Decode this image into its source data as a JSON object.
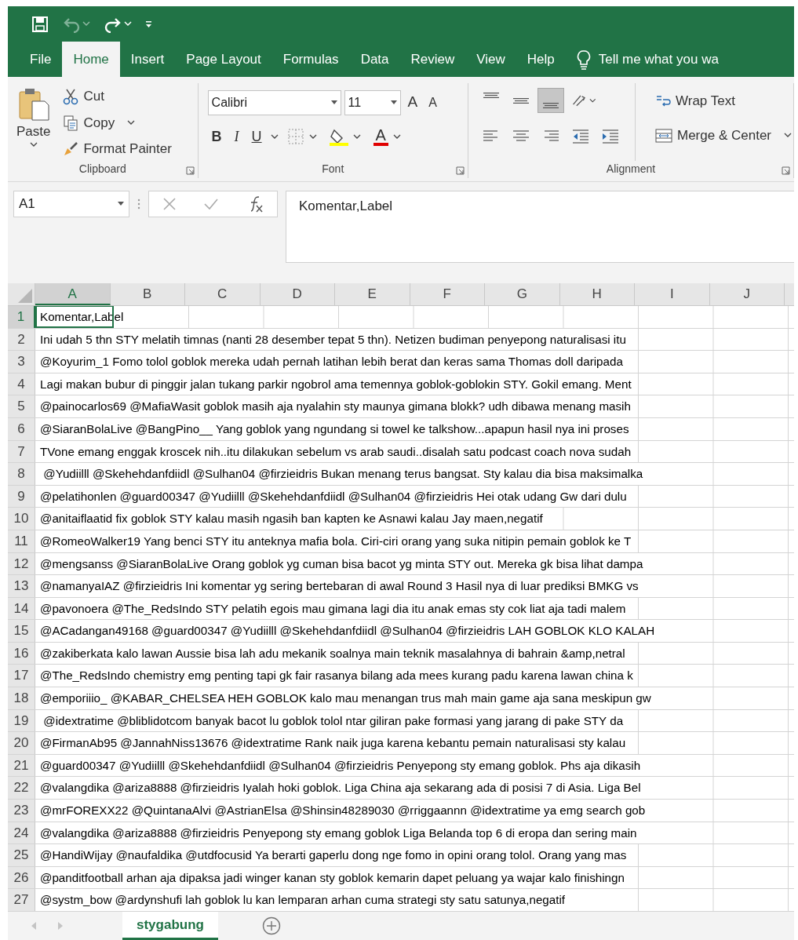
{
  "quick_access": {
    "items": [
      {
        "kind": "save",
        "disabled": false
      },
      {
        "kind": "undo",
        "disabled": true
      },
      {
        "kind": "redo",
        "disabled": false
      },
      {
        "kind": "customize",
        "disabled": false
      }
    ]
  },
  "tabs": [
    {
      "label": "File",
      "selected": false
    },
    {
      "label": "Home",
      "selected": true
    },
    {
      "label": "Insert",
      "selected": false
    },
    {
      "label": "Page Layout",
      "selected": false
    },
    {
      "label": "Formulas",
      "selected": false
    },
    {
      "label": "Data",
      "selected": false
    },
    {
      "label": "Review",
      "selected": false
    },
    {
      "label": "View",
      "selected": false
    },
    {
      "label": "Help",
      "selected": false
    }
  ],
  "tell_me": "Tell me what you wa",
  "ribbon": {
    "clipboard": {
      "label": "Clipboard",
      "paste": "Paste",
      "cut": "Cut",
      "copy": "Copy",
      "format_painter": "Format Painter"
    },
    "font": {
      "label": "Font",
      "font_name": "Calibri",
      "font_size": "11",
      "grow": "A",
      "shrink": "A",
      "bold": "B",
      "italic": "I",
      "underline": "U",
      "font_color": "A"
    },
    "alignment": {
      "label": "Alignment",
      "wrap_text": "Wrap Text",
      "merge_center": "Merge & Center",
      "buttons": [
        {
          "kind": "top",
          "pressed": false
        },
        {
          "kind": "middle",
          "pressed": false
        },
        {
          "kind": "bottom",
          "pressed": true
        },
        {
          "kind": "orientation",
          "pressed": false
        },
        {
          "kind": "left",
          "pressed": false
        },
        {
          "kind": "center",
          "pressed": false
        },
        {
          "kind": "right",
          "pressed": false
        },
        {
          "kind": "outdent",
          "pressed": false
        },
        {
          "kind": "indent",
          "pressed": false
        }
      ]
    }
  },
  "name_box": "A1",
  "formula": "Komentar,Label",
  "columns": [
    {
      "label": "A",
      "selected": true
    },
    {
      "label": "B",
      "selected": false
    },
    {
      "label": "C",
      "selected": false
    },
    {
      "label": "D",
      "selected": false
    },
    {
      "label": "E",
      "selected": false
    },
    {
      "label": "F",
      "selected": false
    },
    {
      "label": "G",
      "selected": false
    },
    {
      "label": "H",
      "selected": false
    },
    {
      "label": "I",
      "selected": false
    },
    {
      "label": "J",
      "selected": false
    }
  ],
  "rows": [
    {
      "number": "1",
      "selected": true,
      "text": "Komentar,Label"
    },
    {
      "number": "2",
      "selected": false,
      "text": "Ini udah 5 thn STY melatih timnas (nanti 28 desember tepat 5 thn). Netizen budiman penyepong naturalisasi itu"
    },
    {
      "number": "3",
      "selected": false,
      "text": "@Koyurim_1 Fomo tolol goblok mereka udah pernah latihan lebih berat dan keras sama Thomas doll daripada"
    },
    {
      "number": "4",
      "selected": false,
      "text": "Lagi makan bubur di pinggir jalan tukang parkir ngobrol ama temennya goblok-goblokin STY. Gokil emang. Ment"
    },
    {
      "number": "5",
      "selected": false,
      "text": "@painocarlos69 @MafiaWasit goblok masih aja nyalahin sty maunya gimana blokk? udh dibawa menang masih"
    },
    {
      "number": "6",
      "selected": false,
      "text": "@SiaranBolaLive @BangPino__ Yang goblok yang ngundang si towel ke talkshow...apapun hasil nya ini proses"
    },
    {
      "number": "7",
      "selected": false,
      "text": "TVone emang enggak kroscek nih..itu dilakukan sebelum vs arab saudi..disalah satu podcast coach nova sudah"
    },
    {
      "number": "8",
      "selected": false,
      "text": " @Yudiilll @Skehehdanfdiidl @Sulhan04 @firzieidris Bukan menang terus bangsat. Sty kalau dia bisa maksimalka"
    },
    {
      "number": "9",
      "selected": false,
      "text": "@pelatihonlen @guard00347 @Yudiilll @Skehehdanfdiidl @Sulhan04 @firzieidris Hei otak udang Gw dari dulu"
    },
    {
      "number": "10",
      "selected": false,
      "text": "@anitaiflaatid fix goblok STY kalau masih ngasih ban kapten ke Asnawi kalau Jay maen,negatif"
    },
    {
      "number": "11",
      "selected": false,
      "text": "@RomeoWalker19 Yang benci STY itu anteknya mafia bola. Ciri-ciri orang yang suka nitipin pemain goblok ke T"
    },
    {
      "number": "12",
      "selected": false,
      "text": "@mengsanss @SiaranBolaLive Orang goblok yg cuman bisa bacot yg minta STY out. Mereka gk bisa lihat dampa"
    },
    {
      "number": "13",
      "selected": false,
      "text": "@namanyaIAZ @firzieidris Ini komentar yg sering bertebaran di awal Round 3 Hasil nya di luar prediksi BMKG vs"
    },
    {
      "number": "14",
      "selected": false,
      "text": "@pavonoera @The_RedsIndo STY pelatih egois mau gimana lagi dia itu anak emas sty cok liat aja tadi malem"
    },
    {
      "number": "15",
      "selected": false,
      "text": "@ACadangan49168 @guard00347 @Yudiilll @Skehehdanfdiidl @Sulhan04 @firzieidris LAH GOBLOK KLO KALAH"
    },
    {
      "number": "16",
      "selected": false,
      "text": "@zakiberkata kalo lawan Aussie bisa lah adu mekanik soalnya main teknik masalahnya di bahrain &amp,netral"
    },
    {
      "number": "17",
      "selected": false,
      "text": "@The_RedsIndo chemistry emg penting tapi gk fair rasanya bilang ada mees kurang padu karena lawan china k"
    },
    {
      "number": "18",
      "selected": false,
      "text": "@emporiiio_ @KABAR_CHELSEA HEH GOBLOK kalo mau menangan trus mah main game aja sana meskipun gw"
    },
    {
      "number": "19",
      "selected": false,
      "text": " @idextratime @bliblidotcom banyak bacot lu goblok tolol ntar giliran pake formasi yang jarang di pake STY da"
    },
    {
      "number": "20",
      "selected": false,
      "text": "@FirmanAb95 @JannahNiss13676 @idextratime Rank naik juga karena kebantu pemain naturalisasi sty kalau"
    },
    {
      "number": "21",
      "selected": false,
      "text": "@guard00347 @Yudiilll @Skehehdanfdiidl @Sulhan04 @firzieidris Penyepong sty emang goblok. Phs aja dikasih"
    },
    {
      "number": "22",
      "selected": false,
      "text": "@valangdika @ariza8888 @firzieidris Iyalah hoki goblok. Liga China aja sekarang ada di posisi 7 di Asia. Liga Bel"
    },
    {
      "number": "23",
      "selected": false,
      "text": "@mrFOREXX22 @QuintanaAlvi @AstrianElsa @Shinsin48289030 @rriggaannn @idextratime ya emg search gob"
    },
    {
      "number": "24",
      "selected": false,
      "text": "@valangdika @ariza8888 @firzieidris Penyepong sty emang goblok Liga Belanda top 6 di eropa dan sering main"
    },
    {
      "number": "25",
      "selected": false,
      "text": "@HandiWijay @naufaldika @utdfocusid Ya berarti gaperlu dong nge fomo in opini orang tolol. Orang yang mas"
    },
    {
      "number": "26",
      "selected": false,
      "text": "@panditfootball arhan aja dipaksa jadi winger kanan sty goblok kemarin dapet peluang ya wajar kalo finishingn"
    },
    {
      "number": "27",
      "selected": false,
      "text": "@systm_bow @ardynshufi lah goblok lu kan lemparan arhan cuma strategi sty satu satunya,negatif"
    }
  ],
  "sheet_tabs": [
    {
      "label": "stygabung",
      "selected": true
    }
  ]
}
